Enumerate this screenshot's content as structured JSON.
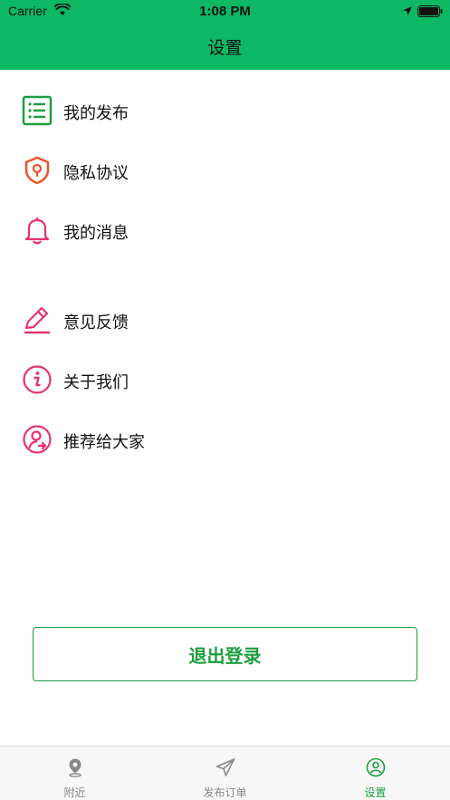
{
  "status_bar": {
    "carrier": "Carrier",
    "time": "1:08 PM"
  },
  "nav": {
    "title": "设置"
  },
  "menu": {
    "items": [
      {
        "label": "我的发布",
        "icon": "list-icon",
        "color": "#1e9e3f"
      },
      {
        "label": "隐私协议",
        "icon": "shield-icon",
        "color": "#e8552a"
      },
      {
        "label": "我的消息",
        "icon": "bell-icon",
        "color": "#e8336d"
      },
      {
        "label": "意见反馈",
        "icon": "pencil-icon",
        "color": "#e8336d"
      },
      {
        "label": "关于我们",
        "icon": "info-icon",
        "color": "#e8336d"
      },
      {
        "label": "推荐给大家",
        "icon": "share-user-icon",
        "color": "#e8336d"
      }
    ]
  },
  "logout": {
    "label": "退出登录"
  },
  "tabs": [
    {
      "label": "附近",
      "icon": "location-pin-icon",
      "active": false
    },
    {
      "label": "发布订单",
      "icon": "paper-plane-icon",
      "active": false
    },
    {
      "label": "设置",
      "icon": "user-circle-icon",
      "active": true
    }
  ],
  "colors": {
    "header_bg": "#0cb863",
    "accent": "#1e9e3f"
  }
}
